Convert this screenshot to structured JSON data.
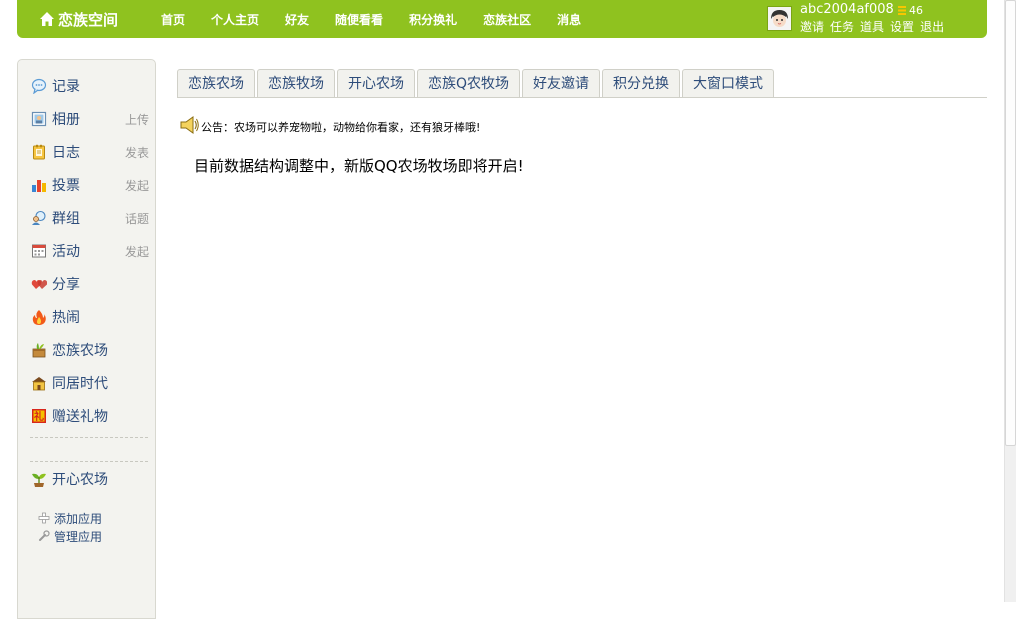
{
  "header": {
    "logo_text": "恋族空间",
    "nav": [
      "首页",
      "个人主页",
      "好友",
      "随便看看",
      "积分换礼",
      "恋族社区",
      "消息"
    ],
    "username": "abc2004af008",
    "coins": "46",
    "user_links": [
      "邀请",
      "任务",
      "道具",
      "设置",
      "退出"
    ],
    "brand_color": "#8fc21f"
  },
  "sidebar": {
    "items": [
      {
        "label": "记录",
        "action": "",
        "icon": "record-icon"
      },
      {
        "label": "相册",
        "action": "上传",
        "icon": "album-icon"
      },
      {
        "label": "日志",
        "action": "发表",
        "icon": "blog-icon"
      },
      {
        "label": "投票",
        "action": "发起",
        "icon": "poll-icon"
      },
      {
        "label": "群组",
        "action": "话题",
        "icon": "group-icon"
      },
      {
        "label": "活动",
        "action": "发起",
        "icon": "event-icon"
      },
      {
        "label": "分享",
        "action": "",
        "icon": "share-icon"
      },
      {
        "label": "热闹",
        "action": "",
        "icon": "hot-icon"
      },
      {
        "label": "恋族农场",
        "action": "",
        "icon": "farm-icon"
      },
      {
        "label": "同居时代",
        "action": "",
        "icon": "house-icon"
      },
      {
        "label": "赠送礼物",
        "action": "",
        "icon": "gift-icon"
      }
    ],
    "apps": [
      {
        "label": "开心农场",
        "icon": "sprout-icon"
      }
    ],
    "app_tools": [
      "添加应用",
      "管理应用"
    ]
  },
  "tabs": [
    "恋族农场",
    "恋族牧场",
    "开心农场",
    "恋族Q农牧场",
    "好友邀请",
    "积分兑换",
    "大窗口模式"
  ],
  "content": {
    "notice": "公告：农场可以养宠物啦，动物给你看家，还有狼牙棒哦!",
    "message": "目前数据结构调整中，新版QQ农场牧场即将开启!"
  }
}
